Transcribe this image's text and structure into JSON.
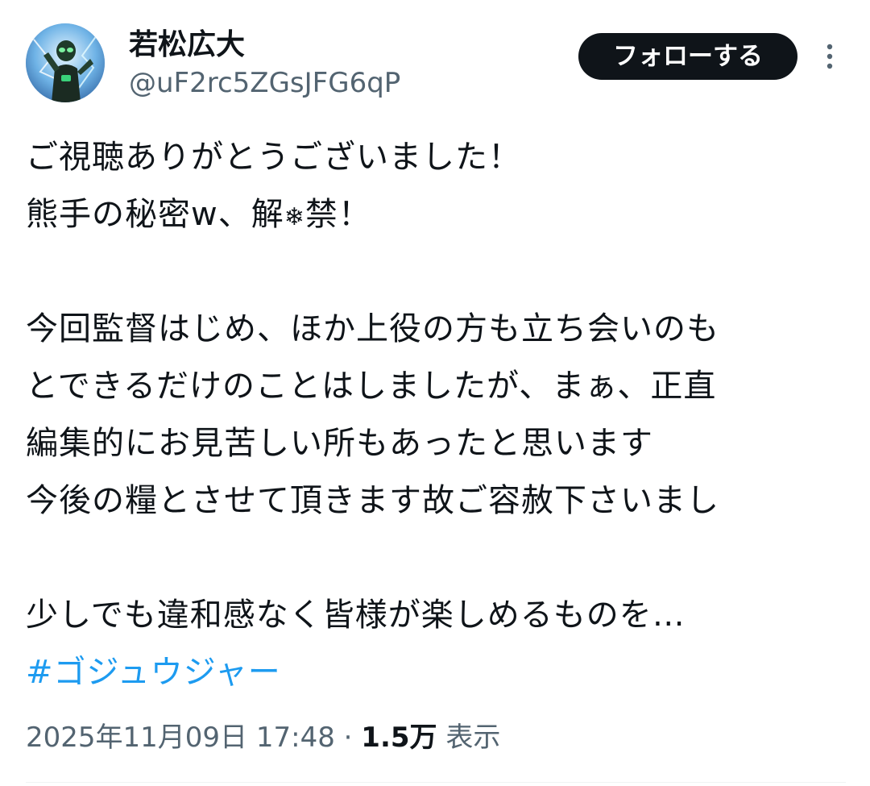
{
  "author": {
    "display_name": "若松広大",
    "handle": "@uF2rc5ZGsJFG6qP",
    "avatar_icon": "avatar-image"
  },
  "header": {
    "follow_label": "フォローする",
    "more_icon": "more-vertical-icon"
  },
  "post": {
    "lines": [
      "ご視聴ありがとうございました！",
      "今回監督はじめ、ほか上役の方も立ち会いのも",
      "とできるだけのことはしましたが、まぁ、正直",
      "編集的にお見苦しい所もあったと思います",
      "今後の糧とさせて頂きます故ご容赦下さいまし",
      "少しでも違和感なく皆様が楽しめるものを…"
    ],
    "line2_before": "熊手の秘密w、解",
    "line2_emoji": "❄",
    "line2_after": "禁！",
    "hashtag": "#ゴジュウジャー"
  },
  "meta": {
    "timestamp": "2025年11月09日 17:48",
    "separator": " · ",
    "views_count": "1.5万",
    "views_label": "表示"
  },
  "colors": {
    "text": "#0f1419",
    "secondary": "#536471",
    "link": "#1d9bf0",
    "button_bg": "#0f1419"
  }
}
